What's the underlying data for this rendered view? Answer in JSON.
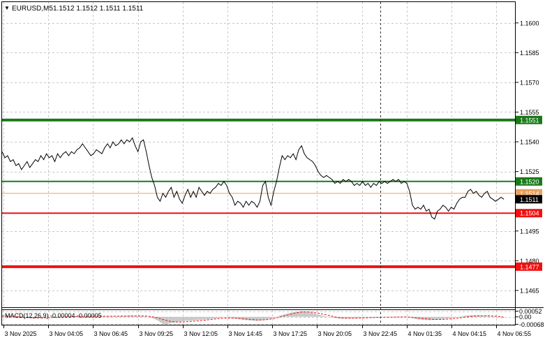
{
  "header": {
    "symbol_tf": "EURUSD,M5",
    "ohlc": "1.1512 1.1512 1.1511 1.1511"
  },
  "price_axis": {
    "ticks": [
      "1.1600",
      "1.1585",
      "1.1570",
      "1.1555",
      "1.1540",
      "1.1525",
      "1.1495",
      "1.1480",
      "1.1465"
    ],
    "tick_values": [
      1.16,
      1.1585,
      1.157,
      1.1555,
      1.154,
      1.1525,
      1.1495,
      1.148,
      1.1465
    ]
  },
  "levels": [
    {
      "label": "1.1551",
      "value": 1.1551,
      "color": "#1a7a1a"
    },
    {
      "label": "1.1520",
      "value": 1.152,
      "color": "#1a7a1a"
    },
    {
      "label": "1.1514",
      "value": 1.1514,
      "color": "#e8a060"
    },
    {
      "label": "1.1511",
      "value": 1.1511,
      "color": "#000000"
    },
    {
      "label": "1.1504",
      "value": 1.1504,
      "color": "#ee1111"
    },
    {
      "label": "1.1477",
      "value": 1.1477,
      "color": "#ee1111"
    }
  ],
  "macd": {
    "label": "MACD(12,26,9) -0.00004 -0.00005",
    "ticks": [
      "0.00052",
      "0.00",
      "-0.00068"
    ],
    "tick_values": [
      0.00052,
      0.0,
      -0.00068
    ]
  },
  "time_axis": {
    "labels": [
      "3 Nov 2025",
      "3 Nov 04:05",
      "3 Nov 06:45",
      "3 Nov 09:25",
      "3 Nov 12:05",
      "3 Nov 14:45",
      "3 Nov 17:25",
      "3 Nov 20:05",
      "3 Nov 22:45",
      "4 Nov 01:35",
      "4 Nov 04:15",
      "4 Nov 06:55"
    ]
  },
  "colors": {
    "price_line": "#000000",
    "macd_hist": "#bdbdbd",
    "macd_signal": "#ee1111",
    "grid": "#c8c8c8",
    "vline": "#333333"
  },
  "chart_data": {
    "type": "line",
    "title": "EURUSD,M5",
    "price_series": [
      [
        0,
        1.1535
      ],
      [
        4,
        1.1532
      ],
      [
        8,
        1.1533
      ],
      [
        12,
        1.153
      ],
      [
        16,
        1.1531
      ],
      [
        20,
        1.1528
      ],
      [
        24,
        1.1529
      ],
      [
        28,
        1.1526
      ],
      [
        32,
        1.1528
      ],
      [
        36,
        1.153
      ],
      [
        40,
        1.1527
      ],
      [
        44,
        1.1529
      ],
      [
        48,
        1.1531
      ],
      [
        52,
        1.153
      ],
      [
        56,
        1.1533
      ],
      [
        60,
        1.1531
      ],
      [
        64,
        1.1534
      ],
      [
        68,
        1.1532
      ],
      [
        72,
        1.1533
      ],
      [
        76,
        1.153
      ],
      [
        80,
        1.1534
      ],
      [
        84,
        1.1532
      ],
      [
        88,
        1.1534
      ],
      [
        92,
        1.1535
      ],
      [
        96,
        1.1533
      ],
      [
        100,
        1.1535
      ],
      [
        104,
        1.1534
      ],
      [
        108,
        1.1536
      ],
      [
        112,
        1.1537
      ],
      [
        116,
        1.1539
      ],
      [
        120,
        1.1537
      ],
      [
        124,
        1.1535
      ],
      [
        128,
        1.1533
      ],
      [
        132,
        1.1534
      ],
      [
        136,
        1.1536
      ],
      [
        140,
        1.1535
      ],
      [
        144,
        1.1534
      ],
      [
        148,
        1.1537
      ],
      [
        152,
        1.1539
      ],
      [
        156,
        1.1537
      ],
      [
        160,
        1.154
      ],
      [
        164,
        1.1538
      ],
      [
        168,
        1.1539
      ],
      [
        172,
        1.1541
      ],
      [
        176,
        1.1539
      ],
      [
        180,
        1.1541
      ],
      [
        184,
        1.154
      ],
      [
        188,
        1.1542
      ],
      [
        192,
        1.1538
      ],
      [
        196,
        1.1535
      ],
      [
        200,
        1.154
      ],
      [
        204,
        1.1541
      ],
      [
        208,
        1.1535
      ],
      [
        212,
        1.1528
      ],
      [
        216,
        1.1522
      ],
      [
        220,
        1.1518
      ],
      [
        224,
        1.1512
      ],
      [
        228,
        1.151
      ],
      [
        232,
        1.1514
      ],
      [
        236,
        1.1512
      ],
      [
        240,
        1.1515
      ],
      [
        244,
        1.1517
      ],
      [
        248,
        1.1512
      ],
      [
        252,
        1.1515
      ],
      [
        256,
        1.1511
      ],
      [
        260,
        1.1509
      ],
      [
        264,
        1.1513
      ],
      [
        268,
        1.1516
      ],
      [
        272,
        1.1512
      ],
      [
        276,
        1.1515
      ],
      [
        280,
        1.1512
      ],
      [
        284,
        1.1517
      ],
      [
        288,
        1.1515
      ],
      [
        292,
        1.1513
      ],
      [
        296,
        1.1515
      ],
      [
        300,
        1.1514
      ],
      [
        304,
        1.1516
      ],
      [
        308,
        1.1517
      ],
      [
        312,
        1.1519
      ],
      [
        316,
        1.1518
      ],
      [
        320,
        1.152
      ],
      [
        324,
        1.1518
      ],
      [
        328,
        1.1514
      ],
      [
        332,
        1.1512
      ],
      [
        336,
        1.1508
      ],
      [
        340,
        1.151
      ],
      [
        344,
        1.1509
      ],
      [
        348,
        1.1507
      ],
      [
        352,
        1.151
      ],
      [
        356,
        1.1508
      ],
      [
        360,
        1.151
      ],
      [
        364,
        1.1509
      ],
      [
        368,
        1.1507
      ],
      [
        372,
        1.151
      ],
      [
        376,
        1.1518
      ],
      [
        380,
        1.152
      ],
      [
        384,
        1.1512
      ],
      [
        388,
        1.1508
      ],
      [
        392,
        1.1515
      ],
      [
        396,
        1.152
      ],
      [
        400,
        1.1527
      ],
      [
        404,
        1.1533
      ],
      [
        408,
        1.1531
      ],
      [
        412,
        1.1533
      ],
      [
        416,
        1.1532
      ],
      [
        420,
        1.1534
      ],
      [
        424,
        1.1531
      ],
      [
        428,
        1.1536
      ],
      [
        432,
        1.1538
      ],
      [
        436,
        1.1534
      ],
      [
        440,
        1.1532
      ],
      [
        444,
        1.1531
      ],
      [
        448,
        1.153
      ],
      [
        452,
        1.1528
      ],
      [
        456,
        1.1525
      ],
      [
        460,
        1.1523
      ],
      [
        464,
        1.1522
      ],
      [
        468,
        1.1523
      ],
      [
        472,
        1.1522
      ],
      [
        476,
        1.1521
      ],
      [
        480,
        1.1519
      ],
      [
        484,
        1.152
      ],
      [
        488,
        1.1519
      ],
      [
        492,
        1.1521
      ],
      [
        496,
        1.152
      ],
      [
        500,
        1.1521
      ],
      [
        504,
        1.152
      ],
      [
        508,
        1.1518
      ],
      [
        512,
        1.1519
      ],
      [
        516,
        1.1518
      ],
      [
        520,
        1.152
      ],
      [
        524,
        1.1518
      ],
      [
        528,
        1.1519
      ],
      [
        532,
        1.1517
      ],
      [
        536,
        1.1519
      ],
      [
        540,
        1.1518
      ],
      [
        544,
        1.152
      ],
      [
        548,
        1.1519
      ],
      [
        552,
        1.152
      ],
      [
        556,
        1.1519
      ],
      [
        560,
        1.152
      ],
      [
        564,
        1.1521
      ],
      [
        568,
        1.152
      ],
      [
        572,
        1.1521
      ],
      [
        576,
        1.1519
      ],
      [
        580,
        1.152
      ],
      [
        584,
        1.1519
      ],
      [
        588,
        1.1515
      ],
      [
        592,
        1.1508
      ],
      [
        596,
        1.1506
      ],
      [
        600,
        1.1507
      ],
      [
        604,
        1.1506
      ],
      [
        608,
        1.1508
      ],
      [
        612,
        1.1505
      ],
      [
        616,
        1.1506
      ],
      [
        620,
        1.1502
      ],
      [
        624,
        1.1501
      ],
      [
        628,
        1.1505
      ],
      [
        632,
        1.1506
      ],
      [
        636,
        1.1508
      ],
      [
        640,
        1.1507
      ],
      [
        644,
        1.1505
      ],
      [
        648,
        1.1507
      ],
      [
        652,
        1.1506
      ],
      [
        656,
        1.1509
      ],
      [
        660,
        1.1511
      ],
      [
        664,
        1.1512
      ],
      [
        668,
        1.1512
      ],
      [
        672,
        1.1515
      ],
      [
        676,
        1.1516
      ],
      [
        680,
        1.1514
      ],
      [
        684,
        1.1515
      ],
      [
        688,
        1.1513
      ],
      [
        692,
        1.1512
      ],
      [
        696,
        1.1514
      ],
      [
        700,
        1.1515
      ],
      [
        704,
        1.1512
      ],
      [
        708,
        1.1511
      ],
      [
        712,
        1.151
      ],
      [
        716,
        1.1511
      ],
      [
        720,
        1.1512
      ],
      [
        724,
        1.1511
      ]
    ],
    "macd_hist": [
      [
        0,
        8e-05
      ],
      [
        8,
        4e-05
      ],
      [
        16,
        -2e-05
      ],
      [
        24,
        -8e-05
      ],
      [
        32,
        -0.00012
      ],
      [
        40,
        -0.00014
      ],
      [
        48,
        -0.00012
      ],
      [
        56,
        -8e-05
      ],
      [
        64,
        -4e-05
      ],
      [
        72,
        -2e-05
      ],
      [
        80,
        0.0
      ],
      [
        88,
        2e-05
      ],
      [
        96,
        0.0
      ],
      [
        104,
        3e-05
      ],
      [
        112,
        6e-05
      ],
      [
        120,
        4e-05
      ],
      [
        128,
        2e-05
      ],
      [
        136,
        4e-05
      ],
      [
        144,
        6e-05
      ],
      [
        152,
        8e-05
      ],
      [
        160,
        6e-05
      ],
      [
        168,
        7e-05
      ],
      [
        176,
        9e-05
      ],
      [
        184,
        0.0001
      ],
      [
        192,
        9e-05
      ],
      [
        200,
        8e-05
      ],
      [
        208,
        4e-05
      ],
      [
        216,
        -0.00012
      ],
      [
        224,
        -0.00034
      ],
      [
        228,
        -0.00052
      ],
      [
        232,
        -0.00066
      ],
      [
        236,
        -0.00068
      ],
      [
        240,
        -0.00062
      ],
      [
        248,
        -0.00052
      ],
      [
        256,
        -0.00044
      ],
      [
        264,
        -0.00036
      ],
      [
        272,
        -0.00034
      ],
      [
        280,
        -0.0003
      ],
      [
        288,
        -0.00026
      ],
      [
        296,
        -0.00022
      ],
      [
        304,
        -0.00016
      ],
      [
        312,
        -0.0001
      ],
      [
        320,
        -4e-05
      ],
      [
        328,
        -8e-05
      ],
      [
        336,
        -0.00016
      ],
      [
        344,
        -0.00024
      ],
      [
        352,
        -0.0003
      ],
      [
        360,
        -0.00034
      ],
      [
        368,
        -0.00036
      ],
      [
        376,
        -0.00028
      ],
      [
        384,
        -0.0002
      ],
      [
        392,
        -8e-05
      ],
      [
        400,
        0.00012
      ],
      [
        408,
        0.00026
      ],
      [
        416,
        0.00038
      ],
      [
        424,
        0.00046
      ],
      [
        432,
        0.00052
      ],
      [
        436,
        0.0005
      ],
      [
        440,
        0.00046
      ],
      [
        448,
        0.00036
      ],
      [
        456,
        0.0002
      ],
      [
        464,
        8e-05
      ],
      [
        472,
        -4e-05
      ],
      [
        480,
        -0.00012
      ],
      [
        488,
        -0.00016
      ],
      [
        496,
        -0.00014
      ],
      [
        504,
        -0.00012
      ],
      [
        512,
        -0.0001
      ],
      [
        520,
        -8e-05
      ],
      [
        528,
        -6e-05
      ],
      [
        536,
        -4e-05
      ],
      [
        544,
        -3e-05
      ],
      [
        552,
        -2e-05
      ],
      [
        560,
        -1e-05
      ],
      [
        568,
        0.0
      ],
      [
        576,
        1e-05
      ],
      [
        584,
        0.0
      ],
      [
        592,
        -0.00014
      ],
      [
        600,
        -0.00024
      ],
      [
        608,
        -0.00028
      ],
      [
        616,
        -0.0003
      ],
      [
        624,
        -0.00028
      ],
      [
        632,
        -0.00022
      ],
      [
        640,
        -0.00016
      ],
      [
        648,
        -0.0001
      ],
      [
        656,
        -2e-05
      ],
      [
        664,
        8e-05
      ],
      [
        672,
        0.00014
      ],
      [
        680,
        0.00016
      ],
      [
        688,
        0.00014
      ],
      [
        696,
        0.0001
      ],
      [
        704,
        6e-05
      ],
      [
        712,
        2e-05
      ],
      [
        720,
        -4e-05
      ],
      [
        724,
        -4e-05
      ]
    ],
    "macd_signal": [
      [
        0,
        0.0001
      ],
      [
        16,
        4e-05
      ],
      [
        32,
        -4e-05
      ],
      [
        48,
        -0.0001
      ],
      [
        64,
        -8e-05
      ],
      [
        80,
        -4e-05
      ],
      [
        96,
        0.0
      ],
      [
        112,
        3e-05
      ],
      [
        128,
        4e-05
      ],
      [
        144,
        5e-05
      ],
      [
        160,
        6e-05
      ],
      [
        176,
        8e-05
      ],
      [
        192,
        9e-05
      ],
      [
        208,
        8e-05
      ],
      [
        216,
        2e-05
      ],
      [
        224,
        -8e-05
      ],
      [
        232,
        -0.00024
      ],
      [
        240,
        -0.00038
      ],
      [
        248,
        -0.00046
      ],
      [
        256,
        -0.00048
      ],
      [
        264,
        -0.00046
      ],
      [
        272,
        -0.00042
      ],
      [
        280,
        -0.00038
      ],
      [
        288,
        -0.00034
      ],
      [
        296,
        -0.00028
      ],
      [
        304,
        -0.00022
      ],
      [
        312,
        -0.00016
      ],
      [
        320,
        -0.00012
      ],
      [
        328,
        -0.0001
      ],
      [
        336,
        -0.00012
      ],
      [
        344,
        -0.00016
      ],
      [
        352,
        -0.0002
      ],
      [
        360,
        -0.00024
      ],
      [
        368,
        -0.00028
      ],
      [
        376,
        -0.00028
      ],
      [
        384,
        -0.00024
      ],
      [
        392,
        -0.00016
      ],
      [
        400,
        -4e-05
      ],
      [
        408,
        0.0001
      ],
      [
        416,
        0.00024
      ],
      [
        424,
        0.00036
      ],
      [
        432,
        0.00044
      ],
      [
        440,
        0.00046
      ],
      [
        448,
        0.00042
      ],
      [
        456,
        0.00034
      ],
      [
        464,
        0.00024
      ],
      [
        472,
        0.00012
      ],
      [
        480,
        0.0
      ],
      [
        488,
        -8e-05
      ],
      [
        496,
        -0.00012
      ],
      [
        504,
        -0.00012
      ],
      [
        512,
        -0.00011
      ],
      [
        520,
        -0.0001
      ],
      [
        528,
        -8e-05
      ],
      [
        536,
        -6e-05
      ],
      [
        544,
        -5e-05
      ],
      [
        552,
        -4e-05
      ],
      [
        560,
        -3e-05
      ],
      [
        568,
        -2e-05
      ],
      [
        576,
        -1e-05
      ],
      [
        584,
        -1e-05
      ],
      [
        592,
        -4e-05
      ],
      [
        600,
        -0.0001
      ],
      [
        608,
        -0.00016
      ],
      [
        616,
        -0.0002
      ],
      [
        624,
        -0.00024
      ],
      [
        632,
        -0.00024
      ],
      [
        640,
        -0.00022
      ],
      [
        648,
        -0.00018
      ],
      [
        656,
        -0.00012
      ],
      [
        664,
        -6e-05
      ],
      [
        672,
        0.0
      ],
      [
        680,
        6e-05
      ],
      [
        688,
        0.0001
      ],
      [
        696,
        0.00011
      ],
      [
        704,
        0.0001
      ],
      [
        712,
        6e-05
      ],
      [
        720,
        2e-05
      ],
      [
        724,
        -5e-05
      ]
    ]
  }
}
